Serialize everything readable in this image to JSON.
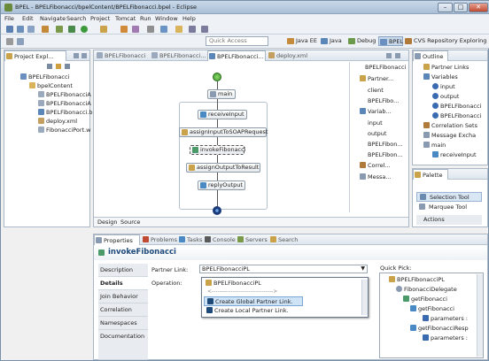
{
  "window": {
    "title": "BPEL - BPELFibonacci/bpelContent/BPELFibonacci.bpel - Eclipse",
    "minimize": "–",
    "maximize": "□",
    "close": "✕"
  },
  "menu": [
    "File",
    "Edit",
    "Navigate",
    "Search",
    "Project",
    "Tomcat",
    "Run",
    "Window",
    "Help"
  ],
  "quick_access": {
    "placeholder": "Quick Access"
  },
  "perspectives": [
    "Java EE",
    "Java",
    "Debug",
    "BPEL",
    "CVS Repository Exploring"
  ],
  "project_explorer": {
    "tab": "Project Expl...",
    "items": [
      "BPELFibonacci",
      "bpelContent",
      "BPELFibonacciA",
      "BPELFibonacciA",
      "BPELFibonacci.b",
      "deploy.xml",
      "FibonacciPort.w"
    ]
  },
  "editor": {
    "tabs": [
      "BPELFibonacci",
      "BPELFibonacci...",
      "BPELFibonacci...",
      "deploy.xml"
    ],
    "nodes": [
      "main",
      "receiveInput",
      "assignInputToSOAPRequest",
      "invokeFibonacci",
      "assignOutputToResult",
      "replyOutput"
    ],
    "bottom_tabs": [
      "Design",
      "Source"
    ],
    "side": {
      "header": "BPELFibonacci",
      "partner": {
        "title": "Partner...",
        "items": [
          "client",
          "BPELFibo..."
        ]
      },
      "variables": {
        "title": "Variab...",
        "items": [
          "input",
          "output",
          "BPELFibon...",
          "BPELFibon..."
        ]
      },
      "correlation": "Correl...",
      "messages": "Messa..."
    }
  },
  "outline": {
    "tab": "Outline",
    "items": [
      "Partner Links",
      "Variables",
      "input",
      "output",
      "BPELFibonacci",
      "BPELFibonacci",
      "Correlation Sets",
      "Message Excha",
      "main",
      "receiveInput"
    ]
  },
  "palette": {
    "title": "Palette",
    "items": [
      "Selection Tool",
      "Marquee Tool",
      "Actions"
    ]
  },
  "bottom": {
    "tabs": [
      "Properties",
      "Problems",
      "Tasks",
      "Console",
      "Servers",
      "Search"
    ],
    "title": "invokeFibonacci",
    "prop_tabs": [
      "Description",
      "Details",
      "Join Behavior",
      "Correlation",
      "Namespaces",
      "Documentation"
    ],
    "partner_link_label": "Partner Link:",
    "partner_link_value": "BPELFibonacciPL",
    "operation_label": "Operation:",
    "dropdown_items": [
      "BPELFibonacciPL",
      "<-------------------------------->",
      "Create Global Partner Link.",
      "Create Local Partner Link."
    ],
    "quick_pick_label": "Quick Pick:",
    "quick_pick_items": [
      "BPELFibonacciPL",
      "FibonacciDelegate",
      "getFibonacci",
      "getFibonacci",
      "parameters :",
      "getFibonacciResp",
      "parameters :"
    ]
  }
}
